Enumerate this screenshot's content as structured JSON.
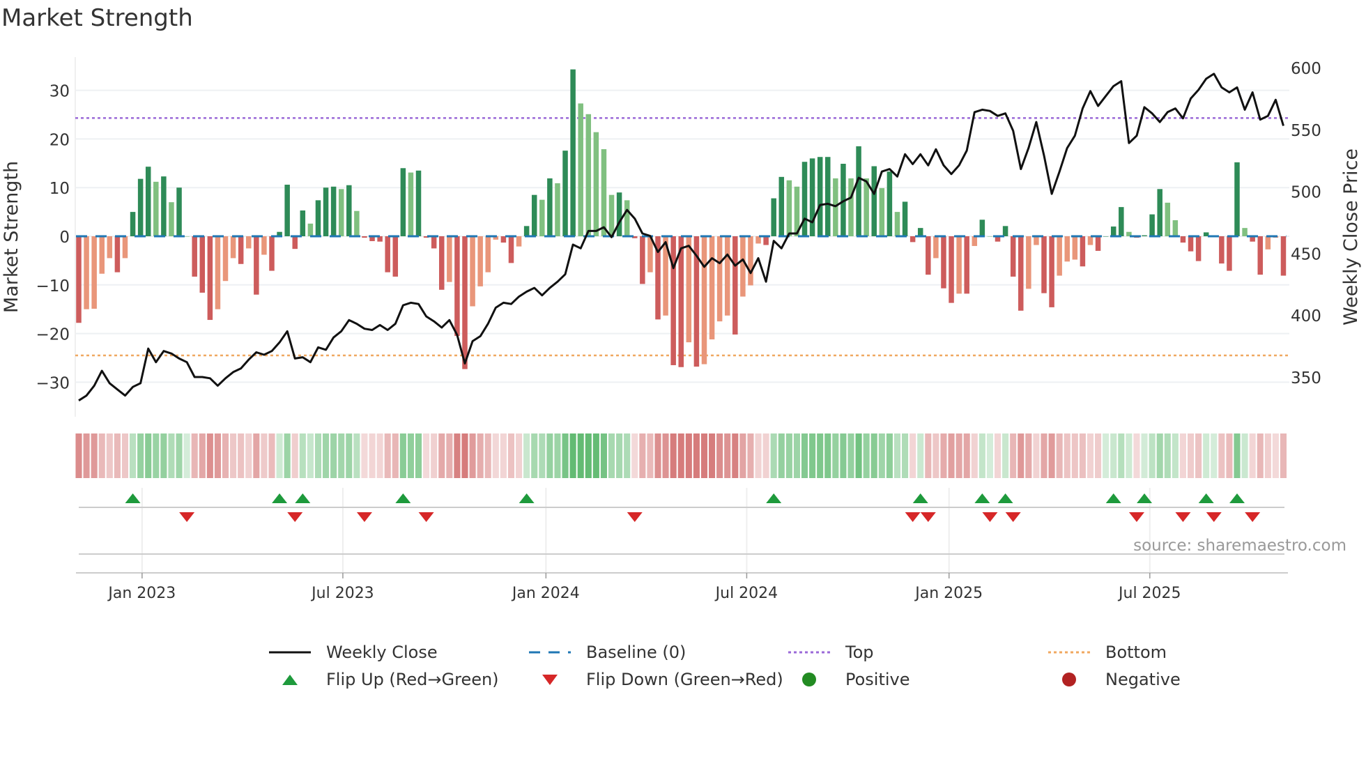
{
  "title": "Market Strength",
  "source": "source: sharemaestro.com",
  "colors": {
    "pos_strong": "#2e8b57",
    "pos_weak": "#80c080",
    "neg_strong": "#cd5c5c",
    "neg_weak": "#e9967a",
    "line": "#111111",
    "baseline": "#1f77b4",
    "top": "#9b6ad8",
    "bottom": "#f0a860",
    "flip_up": "#1e9a3c",
    "flip_down": "#d62728",
    "positive": "#228b22",
    "negative": "#b22222"
  },
  "legend": [
    {
      "label": "Weekly Close",
      "icon": "solid-line"
    },
    {
      "label": "Baseline (0)",
      "icon": "dashed-line"
    },
    {
      "label": "Top",
      "icon": "dotted-line-purple"
    },
    {
      "label": "Bottom",
      "icon": "dotted-line-orange"
    },
    {
      "label": "Flip Up (Red→Green)",
      "icon": "triangle-up"
    },
    {
      "label": "Flip Down (Green→Red)",
      "icon": "triangle-down"
    },
    {
      "label": "Positive",
      "icon": "circle-green"
    },
    {
      "label": "Negative",
      "icon": "circle-red"
    }
  ],
  "chart_data": {
    "type": "bar",
    "title": "Market Strength",
    "ylabel": "Market Strength",
    "y2label": "Weekly Close Price",
    "ylim": [
      -36,
      37
    ],
    "y2lim": [
      318,
      617
    ],
    "yticks": [
      30,
      20,
      10,
      0,
      -10,
      -20,
      -30
    ],
    "yticklabels": [
      "30",
      "20",
      "10",
      "0",
      "−10",
      "−20",
      "−30"
    ],
    "y2ticks": [
      600,
      550,
      500,
      450,
      400,
      350
    ],
    "y2ticklabels": [
      "600",
      "550",
      "500",
      "450",
      "400",
      "350"
    ],
    "x_unit": "weeks (index 0 ≈ Nov 2022)",
    "xticks": [
      8.2,
      34.2,
      60.5,
      86.5,
      112.7,
      138.7
    ],
    "xticklabels": [
      "Jan 2023",
      "Jul 2023",
      "Jan 2024",
      "Jul 2024",
      "Jan 2025",
      "Jul 2025"
    ],
    "top_level": 24.3,
    "bottom_level": -24.5,
    "baseline": 0,
    "grid": true,
    "legend_position": "bottom",
    "strength": [
      -17.8,
      -15,
      -14.9,
      -7.7,
      -4.5,
      -7.4,
      -4.5,
      5,
      11.8,
      14.3,
      11.2,
      12.3,
      7,
      10,
      0,
      -8.3,
      -11.6,
      -17.2,
      -15,
      -9.2,
      -4.5,
      -5.7,
      -2.5,
      -12,
      -3.8,
      -7.1,
      0.9,
      10.6,
      -2.6,
      5.3,
      2.6,
      7.4,
      10,
      10.2,
      9.7,
      10.5,
      5.2,
      -0.3,
      -1,
      -1.1,
      -7.4,
      -8.3,
      14,
      13.1,
      13.5,
      -0.3,
      -2.5,
      -11,
      -9.4,
      -20.5,
      -27.3,
      -14.4,
      -10.3,
      -7.4,
      -0.7,
      -1.3,
      -5.5,
      -2.1,
      2.1,
      8.5,
      7.5,
      11.9,
      10.9,
      17.6,
      34.3,
      27.3,
      25.1,
      21.4,
      17.9,
      8.5,
      9,
      7.4,
      -0.4,
      -9.8,
      -7.4,
      -17.1,
      -16.3,
      -26.5,
      -26.9,
      -21.8,
      -26.8,
      -26.3,
      -21.2,
      -17.5,
      -16.3,
      -20.2,
      -12.4,
      -10.1,
      -1.5,
      -1.8,
      7.8,
      12.2,
      11.5,
      10.2,
      15.3,
      16,
      16.3,
      16.3,
      11.9,
      14.9,
      11.9,
      18.5,
      11.9,
      14.4,
      9.9,
      13.3,
      5,
      7.1,
      -1.2,
      1.7,
      -7.9,
      -4.5,
      -10.7,
      -13.7,
      -11.8,
      -11.8,
      -2,
      3.4,
      0,
      -1.1,
      2.1,
      -8.3,
      -15.3,
      -10.8,
      -1.8,
      -11.7,
      -14.6,
      -8.1,
      -5.2,
      -4.8,
      -6.2,
      -1.8,
      -3,
      0,
      2,
      6,
      0.9,
      -0.3,
      0.2,
      4.5,
      9.7,
      6.9,
      3.3,
      -1.3,
      -3.1,
      -5.1,
      0.8,
      0,
      -5.6,
      -7.1,
      15.2,
      1.7,
      -1.1,
      -7.9,
      -2.7,
      -0.3,
      -8.1
    ],
    "weekly_close": [
      331,
      335,
      343,
      355,
      345,
      340,
      335,
      342,
      345,
      373,
      362,
      371,
      369,
      365,
      362,
      350,
      350,
      349,
      343,
      349,
      354,
      357,
      364,
      370,
      368,
      371,
      378,
      387,
      365,
      366,
      362,
      374,
      372,
      382,
      387,
      396,
      393,
      389,
      388,
      392,
      388,
      393,
      408,
      410,
      409,
      399,
      395,
      390,
      396,
      384,
      361,
      379,
      383,
      393,
      406,
      410,
      409,
      415,
      419,
      422,
      416,
      422,
      427,
      433,
      457,
      454,
      468,
      468,
      471,
      463,
      475,
      485,
      478,
      466,
      464,
      451,
      459,
      438,
      454,
      456,
      448,
      439,
      446,
      442,
      449,
      440,
      445,
      434,
      446,
      427,
      460,
      454,
      466,
      466,
      478,
      475,
      489,
      490,
      488,
      492,
      495,
      511,
      508,
      498,
      516,
      518,
      512,
      530,
      522,
      530,
      521,
      534,
      521,
      514,
      521,
      533,
      564,
      566,
      565,
      561,
      563,
      549,
      518,
      535,
      556,
      529,
      498,
      516,
      535,
      545,
      567,
      581,
      569,
      577,
      585,
      589,
      539,
      545,
      568,
      563,
      556,
      564,
      567,
      559,
      575,
      582,
      591,
      595,
      584,
      580,
      584,
      566,
      580,
      558,
      561,
      574,
      553
    ],
    "flip_up_weeks": [
      7,
      26,
      29,
      42,
      58,
      90,
      109,
      117,
      120,
      134,
      138,
      146,
      150
    ],
    "flip_down_weeks": [
      14,
      28,
      37,
      45,
      72,
      108,
      110,
      118,
      121,
      137,
      143,
      147,
      152
    ]
  }
}
